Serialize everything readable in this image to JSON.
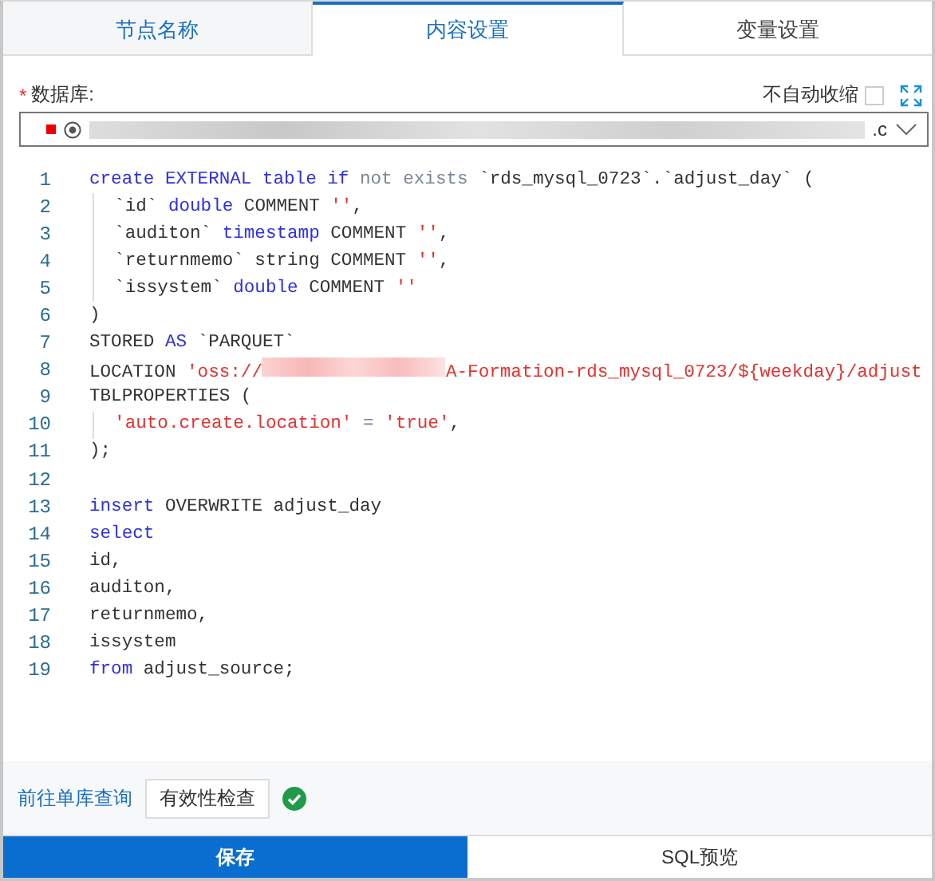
{
  "tabs": [
    {
      "label": "节点名称",
      "selected": false,
      "completed": true
    },
    {
      "label": "内容设置",
      "selected": true,
      "completed": false
    },
    {
      "label": "变量设置",
      "selected": false,
      "completed": false
    }
  ],
  "database": {
    "label": "数据库:",
    "required_mark": "*",
    "value_tail": ".c",
    "auto_collapse": {
      "label": "不自动收缩",
      "checked": false
    }
  },
  "editor": {
    "lines": [
      {
        "number": "1",
        "indented": false,
        "tokens": [
          {
            "kind": "keyword",
            "text": "create EXTERNAL table if "
          },
          {
            "kind": "operator",
            "text": "not exists "
          },
          {
            "kind": "plain",
            "text": "`rds_mysql_0723`.`adjust_day` ("
          }
        ]
      },
      {
        "number": "2",
        "indented": true,
        "tokens": [
          {
            "kind": "plain",
            "text": "`id` "
          },
          {
            "kind": "keyword",
            "text": "double"
          },
          {
            "kind": "plain",
            "text": " COMMENT "
          },
          {
            "kind": "string",
            "text": "''"
          },
          {
            "kind": "plain",
            "text": ","
          }
        ]
      },
      {
        "number": "3",
        "indented": true,
        "tokens": [
          {
            "kind": "plain",
            "text": "`auditon` "
          },
          {
            "kind": "keyword",
            "text": "timestamp"
          },
          {
            "kind": "plain",
            "text": " COMMENT "
          },
          {
            "kind": "string",
            "text": "''"
          },
          {
            "kind": "plain",
            "text": ","
          }
        ]
      },
      {
        "number": "4",
        "indented": true,
        "tokens": [
          {
            "kind": "plain",
            "text": "`returnmemo` string COMMENT "
          },
          {
            "kind": "string",
            "text": "''"
          },
          {
            "kind": "plain",
            "text": ","
          }
        ]
      },
      {
        "number": "5",
        "indented": true,
        "tokens": [
          {
            "kind": "plain",
            "text": "`issystem` "
          },
          {
            "kind": "keyword",
            "text": "double"
          },
          {
            "kind": "plain",
            "text": " COMMENT "
          },
          {
            "kind": "string",
            "text": "''"
          }
        ]
      },
      {
        "number": "6",
        "indented": false,
        "tokens": [
          {
            "kind": "plain",
            "text": ")"
          }
        ]
      },
      {
        "number": "7",
        "indented": false,
        "tokens": [
          {
            "kind": "plain",
            "text": "STORED "
          },
          {
            "kind": "keyword",
            "text": "AS"
          },
          {
            "kind": "plain",
            "text": " `PARQUET`"
          }
        ]
      },
      {
        "number": "8",
        "indented": false,
        "tokens": [
          {
            "kind": "plain",
            "text": "LOCATION "
          },
          {
            "kind": "string",
            "text": "'oss://"
          },
          {
            "kind": "redacted"
          },
          {
            "kind": "string",
            "text": "A-Formation-rds_mysql_0723/${weekday}/adjust"
          }
        ]
      },
      {
        "number": "9",
        "indented": false,
        "tokens": [
          {
            "kind": "plain",
            "text": "TBLPROPERTIES ("
          }
        ]
      },
      {
        "number": "10",
        "indented": true,
        "tokens": [
          {
            "kind": "string",
            "text": "'auto.create.location'"
          },
          {
            "kind": "operator",
            "text": " = "
          },
          {
            "kind": "string",
            "text": "'true'"
          },
          {
            "kind": "plain",
            "text": ","
          }
        ]
      },
      {
        "number": "11",
        "indented": false,
        "tokens": [
          {
            "kind": "plain",
            "text": ");"
          }
        ]
      },
      {
        "number": "12",
        "indented": false
      },
      {
        "number": "13",
        "indented": false,
        "tokens": [
          {
            "kind": "keyword",
            "text": "insert"
          },
          {
            "kind": "plain",
            "text": " OVERWRITE adjust_day"
          }
        ]
      },
      {
        "number": "14",
        "indented": false,
        "tokens": [
          {
            "kind": "keyword",
            "text": "select"
          }
        ]
      },
      {
        "number": "15",
        "indented": false,
        "tokens": [
          {
            "kind": "plain",
            "text": "id,"
          }
        ]
      },
      {
        "number": "16",
        "indented": false,
        "tokens": [
          {
            "kind": "plain",
            "text": "auditon,"
          }
        ]
      },
      {
        "number": "17",
        "indented": false,
        "tokens": [
          {
            "kind": "plain",
            "text": "returnmemo,"
          }
        ]
      },
      {
        "number": "18",
        "indented": false,
        "tokens": [
          {
            "kind": "plain",
            "text": "issystem"
          }
        ]
      },
      {
        "number": "19",
        "indented": false,
        "tokens": [
          {
            "kind": "keyword",
            "text": "from"
          },
          {
            "kind": "plain",
            "text": " adjust_source;"
          }
        ]
      }
    ]
  },
  "footer": {
    "link": "前往单库查询",
    "check_button": "有效性检查",
    "valid": true
  },
  "actions": [
    {
      "label": "保存",
      "primary": true
    },
    {
      "label": "SQL预览",
      "primary": false
    }
  ]
}
